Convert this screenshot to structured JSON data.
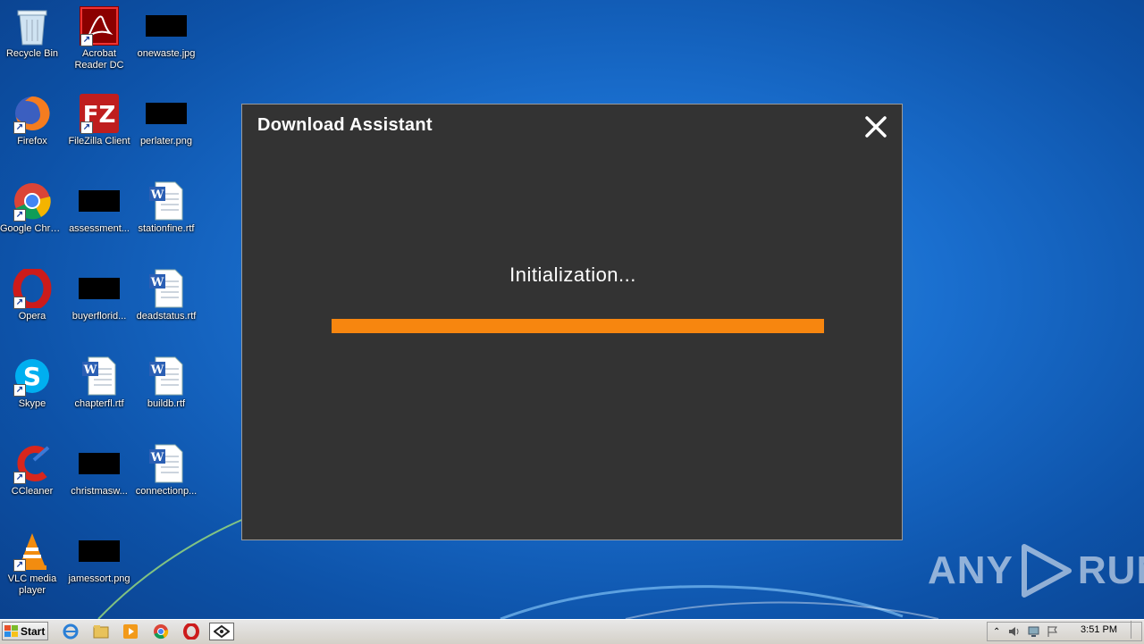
{
  "desktop": {
    "icons": [
      {
        "label": "Recycle Bin",
        "icon": "recycle-bin-icon"
      },
      {
        "label": "Acrobat Reader DC",
        "icon": "acrobat-icon"
      },
      {
        "label": "onewaste.jpg",
        "icon": "image-file-icon"
      },
      {
        "label": "Firefox",
        "icon": "firefox-icon"
      },
      {
        "label": "FileZilla Client",
        "icon": "filezilla-icon"
      },
      {
        "label": "perlater.png",
        "icon": "image-file-icon"
      },
      {
        "label": "Google Chrome",
        "icon": "chrome-icon"
      },
      {
        "label": "assessment...",
        "icon": "image-file-icon"
      },
      {
        "label": "stationfine.rtf",
        "icon": "word-document-icon"
      },
      {
        "label": "Opera",
        "icon": "opera-icon"
      },
      {
        "label": "buyerflorid...",
        "icon": "image-file-icon"
      },
      {
        "label": "deadstatus.rtf",
        "icon": "word-document-icon"
      },
      {
        "label": "Skype",
        "icon": "skype-icon"
      },
      {
        "label": "chapterfl.rtf",
        "icon": "word-document-icon"
      },
      {
        "label": "buildb.rtf",
        "icon": "word-document-icon"
      },
      {
        "label": "CCleaner",
        "icon": "ccleaner-icon"
      },
      {
        "label": "christmasw...",
        "icon": "image-file-icon"
      },
      {
        "label": "connectionp...",
        "icon": "word-document-icon"
      },
      {
        "label": "VLC media player",
        "icon": "vlc-icon"
      },
      {
        "label": "jamessort.png",
        "icon": "image-file-icon"
      }
    ]
  },
  "dialog": {
    "title": "Download Assistant",
    "status": "Initialization...",
    "progress": 1.0,
    "accent": "#f7860f"
  },
  "watermark": {
    "left": "ANY",
    "right": "RUN"
  },
  "taskbar": {
    "start_label": "Start",
    "clock": "3:51 PM"
  }
}
